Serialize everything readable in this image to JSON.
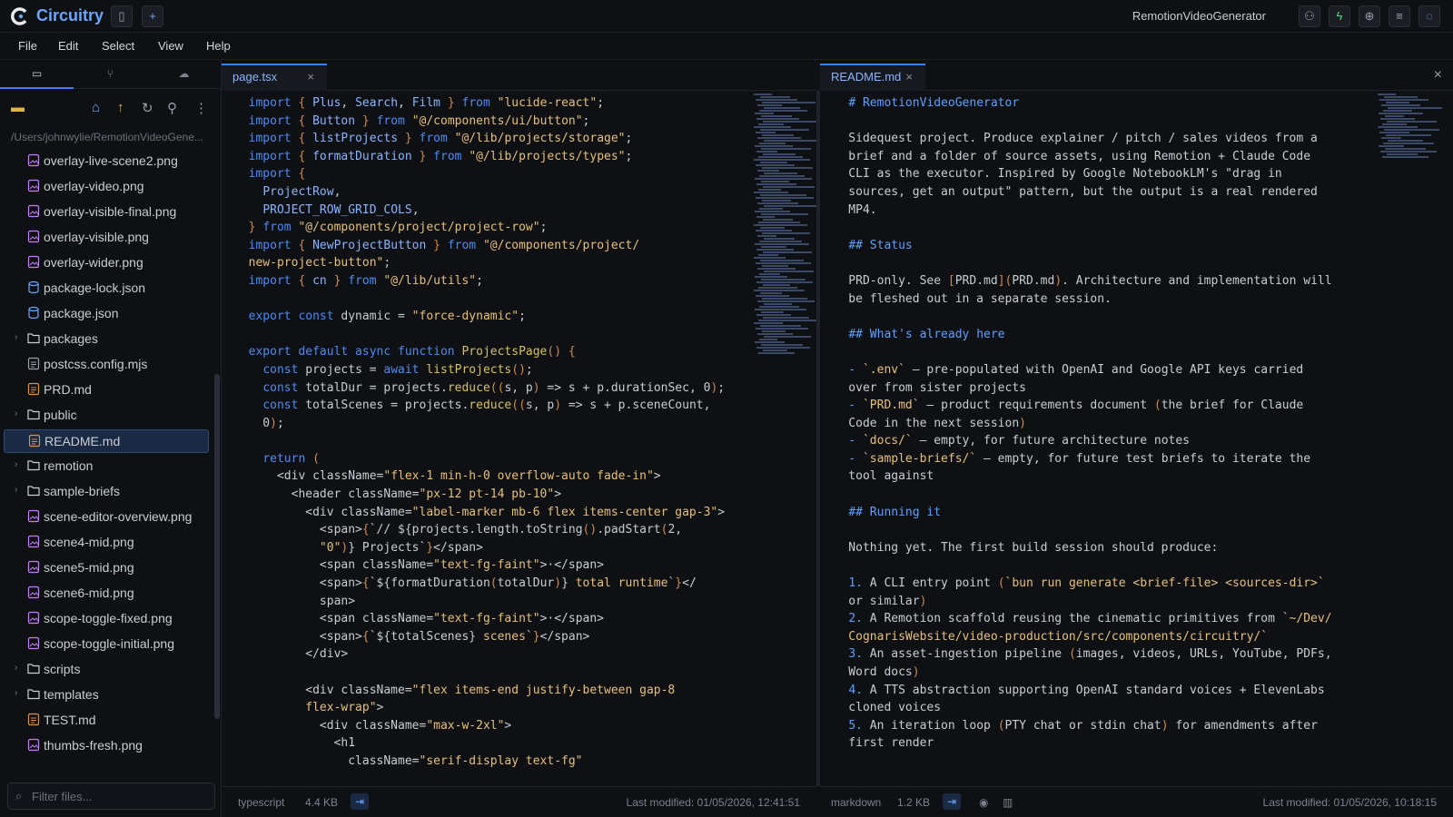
{
  "app": {
    "name": "Circuitry",
    "project": "RemotionVideoGenerator"
  },
  "menu": [
    "File",
    "Edit",
    "Select",
    "View",
    "Help"
  ],
  "sidebar": {
    "path": "/Users/johnwylie/RemotionVideoGene...",
    "filter_placeholder": "Filter files...",
    "files": [
      {
        "name": "overlay-live-scene2.png",
        "type": "image"
      },
      {
        "name": "overlay-video.png",
        "type": "image"
      },
      {
        "name": "overlay-visible-final.png",
        "type": "image"
      },
      {
        "name": "overlay-visible.png",
        "type": "image"
      },
      {
        "name": "overlay-wider.png",
        "type": "image"
      },
      {
        "name": "package-lock.json",
        "type": "json"
      },
      {
        "name": "package.json",
        "type": "json"
      },
      {
        "name": "packages",
        "type": "folder"
      },
      {
        "name": "postcss.config.mjs",
        "type": "file"
      },
      {
        "name": "PRD.md",
        "type": "md"
      },
      {
        "name": "public",
        "type": "folder"
      },
      {
        "name": "README.md",
        "type": "md"
      },
      {
        "name": "remotion",
        "type": "folder"
      },
      {
        "name": "sample-briefs",
        "type": "folder"
      },
      {
        "name": "scene-editor-overview.png",
        "type": "image"
      },
      {
        "name": "scene4-mid.png",
        "type": "image"
      },
      {
        "name": "scene5-mid.png",
        "type": "image"
      },
      {
        "name": "scene6-mid.png",
        "type": "image"
      },
      {
        "name": "scope-toggle-fixed.png",
        "type": "image"
      },
      {
        "name": "scope-toggle-initial.png",
        "type": "image"
      },
      {
        "name": "scripts",
        "type": "folder"
      },
      {
        "name": "templates",
        "type": "folder"
      },
      {
        "name": "TEST.md",
        "type": "md"
      },
      {
        "name": "thumbs-fresh.png",
        "type": "image"
      }
    ]
  },
  "left_pane": {
    "tab": "page.tsx",
    "status": {
      "language": "typescript",
      "size": "4.4 KB",
      "modified": "Last modified: 01/05/2026, 12:41:51"
    }
  },
  "right_pane": {
    "tab": "README.md",
    "status": {
      "language": "markdown",
      "size": "1.2 KB",
      "modified": "Last modified: 01/05/2026, 10:18:15"
    }
  }
}
